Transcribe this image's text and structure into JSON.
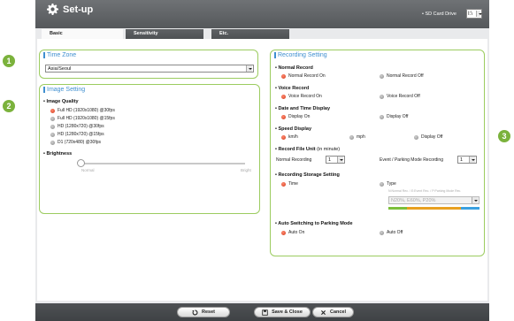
{
  "window": {
    "title": "Set-up"
  },
  "sd_card": {
    "label": "• SD Card Drive",
    "value": "I:\\"
  },
  "tabs": [
    {
      "label": "Basic"
    },
    {
      "label": "Sensitivity"
    },
    {
      "label": "Etc."
    }
  ],
  "callouts": [
    "1",
    "2",
    "3"
  ],
  "time_zone": {
    "title": "Time Zone",
    "value": "Asia/Seoul"
  },
  "image_setting": {
    "title": "Image Setting",
    "quality_label": "• Image Quality",
    "quality_options": [
      "Full HD (1920x1080) @30fps",
      "Full HD (1920x1080) @15fps",
      "HD (1280x720) @30fps",
      "HD (1280x720) @15fps",
      "D1 (720x480) @30fps"
    ],
    "quality_selected_index": 0,
    "brightness_label": "• Brightness",
    "brightness_min": "Normal",
    "brightness_max": "Bright",
    "brightness_level": 0
  },
  "recording": {
    "title": "Recording Setting",
    "normal_record": {
      "label": "• Normal Record",
      "on": "Normal Record On",
      "off": "Normal Record Off"
    },
    "voice_record": {
      "label": "• Voice Record",
      "on": "Voice Record On",
      "off": "Voice Record Off"
    },
    "date_time": {
      "label": "• Date and Time Display",
      "on": "Display On",
      "off": "Display Off"
    },
    "speed": {
      "label": "• Speed Display",
      "kmh": "km/h",
      "mph": "mph",
      "off": "Display Off"
    },
    "file_unit": {
      "label": "• Record File Unit",
      "label_note": "(in minute)",
      "normal_label": "Normal Recording",
      "normal_value": "1",
      "event_label": "Event / Parking Mode Recording",
      "event_value": "1"
    },
    "storage": {
      "label": "• Recording Storage Setting",
      "time": "Time",
      "type": "Type",
      "type_legend": "N:Normal Rec. / E:Event Rec. / P:Parking Mode Rec.",
      "type_value": "N20%, E60%, P20%",
      "type_bar_colors": [
        "#7bbf3a",
        "#e8a020",
        "#3aa0e0"
      ],
      "type_bar_shares": [
        0.2,
        0.6,
        0.2
      ]
    },
    "auto_parking": {
      "label": "• Auto Switching to Parking Mode",
      "on": "Auto On",
      "off": "Auto Off"
    }
  },
  "buttons": {
    "reset": "Reset",
    "save_close": "Save & Close",
    "cancel": "Cancel"
  },
  "colors": {
    "accent_green": "#7bb23c",
    "title_blue": "#3f8fd0",
    "radio_on": "#d23a1c"
  }
}
